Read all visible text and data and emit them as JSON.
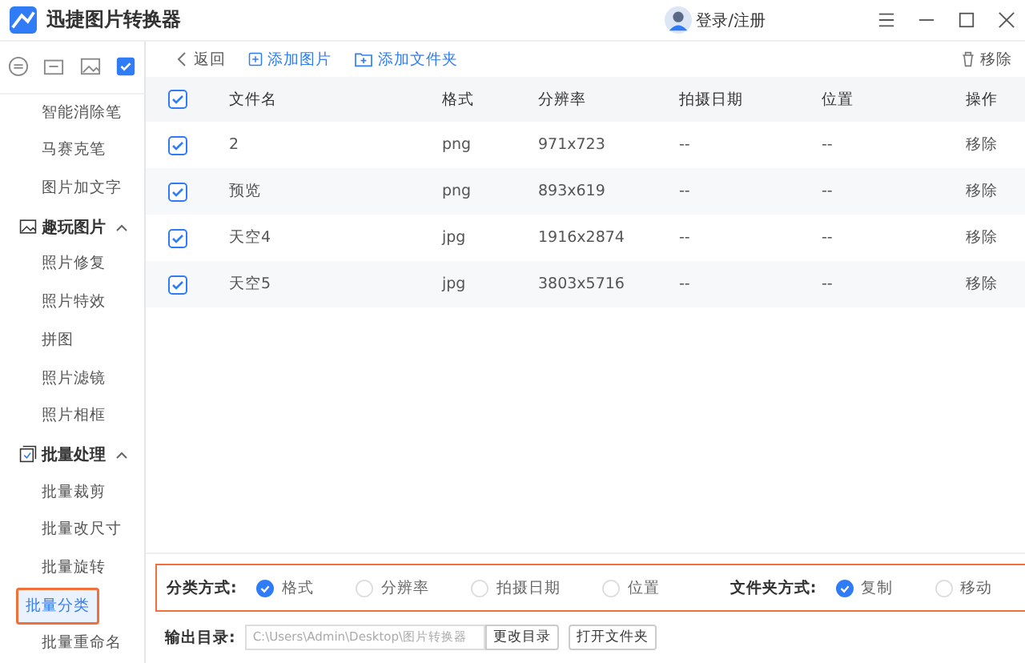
{
  "window": {
    "title": "迅捷图片转换器",
    "user": "登录/注册"
  },
  "sidebar": {
    "tools": [
      {
        "selected": false
      },
      {
        "selected": false
      },
      {
        "selected": false
      },
      {
        "selected": true
      }
    ],
    "items": [
      {
        "kind": "item",
        "label": "智能消除笔",
        "selected": false
      },
      {
        "kind": "item",
        "label": "马赛克笔",
        "selected": false
      },
      {
        "kind": "item",
        "label": "图片加文字",
        "selected": false
      },
      {
        "kind": "group",
        "label": "趣玩图片",
        "expanded": true,
        "children": [
          {
            "label": "照片修复",
            "selected": false
          },
          {
            "label": "照片特效",
            "selected": false
          },
          {
            "label": "拼图",
            "selected": false
          },
          {
            "label": "照片滤镜",
            "selected": false
          },
          {
            "label": "照片相框",
            "selected": false
          }
        ]
      },
      {
        "kind": "group",
        "label": "批量处理",
        "expanded": true,
        "children": [
          {
            "label": "批量裁剪",
            "selected": false
          },
          {
            "label": "批量改尺寸",
            "selected": false
          },
          {
            "label": "批量旋转",
            "selected": false
          },
          {
            "label": "批量分类",
            "selected": true
          },
          {
            "label": "批量重命名",
            "selected": false
          }
        ]
      }
    ]
  },
  "toolbar": {
    "back": "返回",
    "add_image": "添加图片",
    "add_folder": "添加文件夹",
    "remove": "移除"
  },
  "table": {
    "columns": [
      "文件名",
      "格式",
      "分辨率",
      "拍摄日期",
      "位置",
      "操作"
    ],
    "all_checked": true,
    "rows": [
      {
        "checked": true,
        "cells": [
          "2",
          "png",
          "971x723",
          "--",
          "--"
        ],
        "action": "移除"
      },
      {
        "checked": true,
        "cells": [
          "预览",
          "png",
          "893x619",
          "--",
          "--"
        ],
        "action": "移除"
      },
      {
        "checked": true,
        "cells": [
          "天空4",
          "jpg",
          "1916x2874",
          "--",
          "--"
        ],
        "action": "移除"
      },
      {
        "checked": true,
        "cells": [
          "天空5",
          "jpg",
          "3803x5716",
          "--",
          "--"
        ],
        "action": "移除"
      }
    ]
  },
  "classify": {
    "label": "分类方式:",
    "options": [
      {
        "label": "格式",
        "selected": true
      },
      {
        "label": "分辨率",
        "selected": false
      },
      {
        "label": "拍摄日期",
        "selected": false
      },
      {
        "label": "位置",
        "selected": false
      }
    ],
    "folder_label": "文件夹方式:",
    "folder_options": [
      {
        "label": "复制",
        "selected": true
      },
      {
        "label": "移动",
        "selected": false
      }
    ]
  },
  "output": {
    "label": "输出目录:",
    "value": "C:\\Users\\Admin\\Desktop\\图片转换器",
    "change": "更改目录",
    "open": "打开文件夹"
  }
}
